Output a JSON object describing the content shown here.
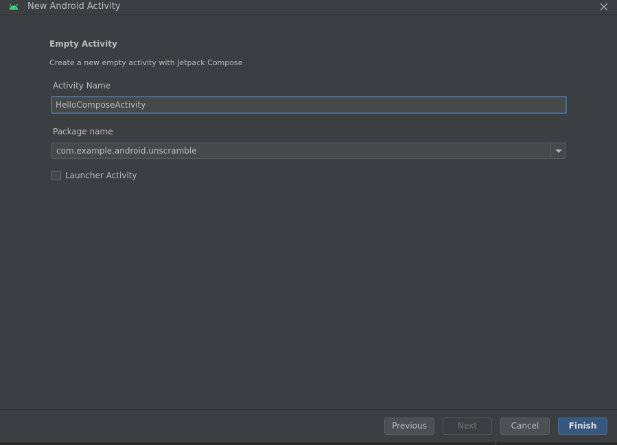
{
  "window": {
    "title": "New Android Activity",
    "icon": "android-icon"
  },
  "form": {
    "heading": "Empty Activity",
    "description": "Create a new empty activity with Jetpack Compose",
    "activity_name_label": "Activity Name",
    "activity_name_value": "HelloComposeActivity",
    "package_name_label": "Package name",
    "package_name_value": "com.example.android.unscramble",
    "launcher_label": "Launcher Activity",
    "launcher_checked": false
  },
  "footer": {
    "previous_label": "Previous",
    "next_label": "Next",
    "cancel_label": "Cancel",
    "finish_label": "Finish"
  },
  "colors": {
    "background": "#3c3f41",
    "focus_border": "#466d94",
    "primary_button": "#365880",
    "android_green": "#3ddc84"
  }
}
